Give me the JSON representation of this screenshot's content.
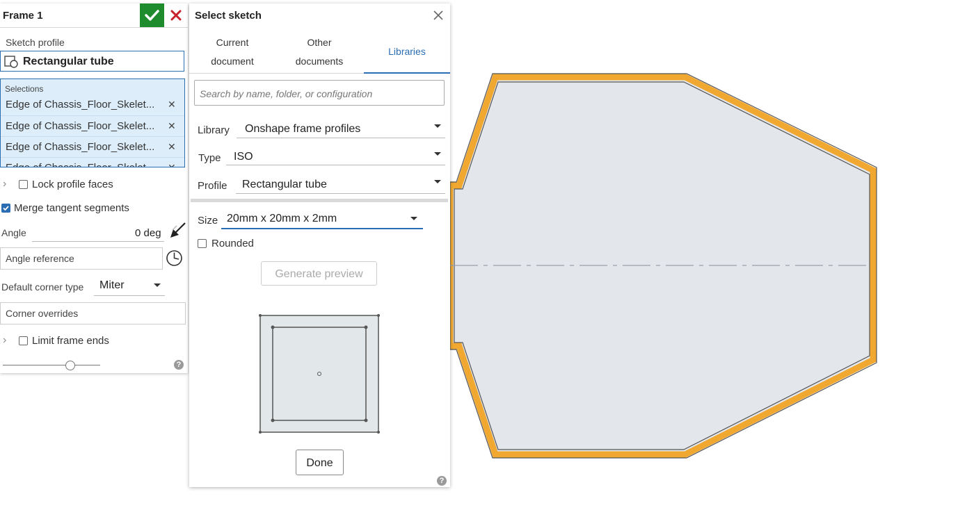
{
  "frame_panel": {
    "title": "Frame 1",
    "sketch_profile_label": "Sketch profile",
    "sketch_profile_value": "Rectangular tube",
    "selections_label": "Selections",
    "selections": [
      "Edge of Chassis_Floor_Skelet...",
      "Edge of Chassis_Floor_Skelet...",
      "Edge of Chassis_Floor_Skelet...",
      "Edge of Chassis_Floor_Skelet..."
    ],
    "lock_profile_faces_label": "Lock profile faces",
    "merge_tangent_label": "Merge tangent segments",
    "angle_label": "Angle",
    "angle_value": "0 deg",
    "angle_reference_placeholder": "Angle reference",
    "default_corner_label": "Default corner type",
    "default_corner_value": "Miter",
    "corner_overrides_placeholder": "Corner overrides",
    "limit_frame_ends_label": "Limit frame ends",
    "help_label": "?"
  },
  "sketch_dialog": {
    "title": "Select sketch",
    "tabs": [
      {
        "line1": "Current",
        "line2": "document"
      },
      {
        "line1": "Other",
        "line2": "documents"
      },
      {
        "line1": "Libraries",
        "line2": ""
      }
    ],
    "search_placeholder": "Search by name, folder, or configuration",
    "library_label": "Library",
    "library_value": "Onshape frame profiles",
    "type_label": "Type",
    "type_value": "ISO",
    "profile_label": "Profile",
    "profile_value": "Rectangular tube",
    "size_label": "Size",
    "size_value": "20mm x 20mm x 2mm",
    "rounded_label": "Rounded",
    "generate_preview_label": "Generate preview",
    "done_label": "Done",
    "help_label": "?"
  },
  "colors": {
    "accent": "#2a6db3",
    "confirm": "#1e8c2c",
    "cancel": "#c8202a",
    "selection_bg": "#ddeefa",
    "frame_orange": "#f0a830",
    "part_fill": "#e3e6ea"
  }
}
